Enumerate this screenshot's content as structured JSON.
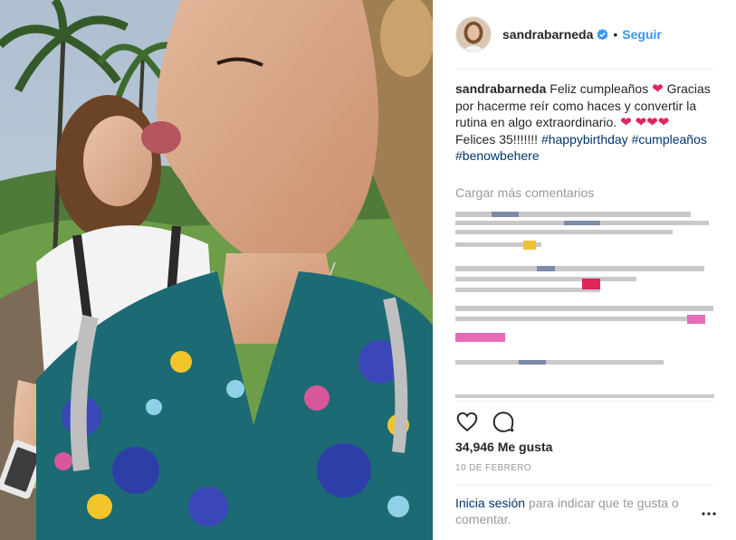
{
  "post": {
    "username": "sandrabarneda",
    "dot": "•",
    "follow_label": "Seguir",
    "caption": {
      "username": "sandrabarneda",
      "line1": "Feliz cumpleaños",
      "line2": "Gracias por hacerme reír como haces y convertir la rutina en algo extraordinario.",
      "heart_single": "❤",
      "heart_triple": "❤❤❤",
      "line3": "Felices 35!!!!!!!",
      "hashtag1": "#happybirthday",
      "hashtag2": "#cumpleaños",
      "hashtag3": "#benowbehere"
    },
    "load_more": "Cargar más comentarios",
    "likes": "34,946 Me gusta",
    "date": "10 DE FEBRERO",
    "login_link": "Inicia sesión",
    "login_rest": " para indicar que te gusta o comentar."
  },
  "colors": {
    "accent": "#3897f0",
    "link": "#003569",
    "muted": "#999999",
    "heart": "#e0245e"
  },
  "icons": [
    "verified-badge-icon",
    "heart-icon",
    "comment-icon",
    "more-options-icon"
  ]
}
